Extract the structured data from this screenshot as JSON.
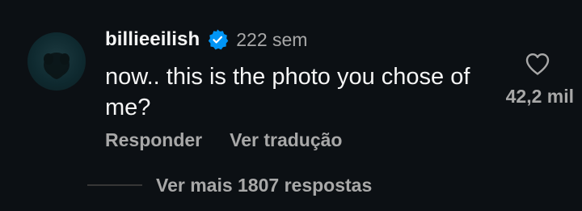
{
  "comment": {
    "username": "billieeilish",
    "verified": true,
    "time": "222 sem",
    "text": "now.. this is the photo you chose of me?",
    "actions": {
      "reply_label": "Responder",
      "translate_label": "Ver tradução"
    },
    "likes": "42,2 mil",
    "replies_label": "Ver mais 1807 respostas"
  },
  "icons": {
    "avatar": "profile-avatar",
    "verified": "verified-badge-icon",
    "like": "heart-outline-icon"
  },
  "colors": {
    "background": "#0c1014",
    "primary_text": "#f5f5f5",
    "secondary_text": "#a8a8a8",
    "verified_blue": "#0095f6",
    "divider": "#363636"
  }
}
